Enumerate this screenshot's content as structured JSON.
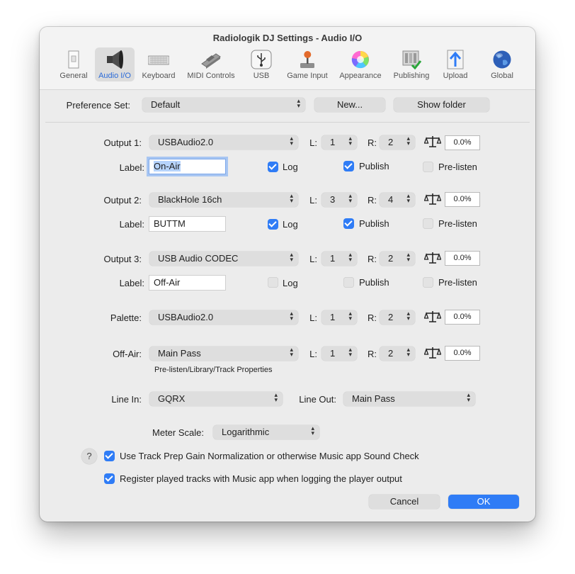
{
  "window": {
    "title": "Radiologik DJ Settings - Audio I/O"
  },
  "toolbar": [
    {
      "label": "General",
      "icon": "general-icon"
    },
    {
      "label": "Audio I/O",
      "icon": "speaker-icon",
      "selected": true
    },
    {
      "label": "Keyboard",
      "icon": "keyboard-icon"
    },
    {
      "label": "MIDI Controls",
      "icon": "midi-fader-icon"
    },
    {
      "label": "USB",
      "icon": "usb-icon"
    },
    {
      "label": "Game Input",
      "icon": "joystick-icon"
    },
    {
      "label": "Appearance",
      "icon": "color-wheel-icon"
    },
    {
      "label": "Publishing",
      "icon": "publishing-icon"
    },
    {
      "label": "Upload",
      "icon": "upload-arrow-icon"
    },
    {
      "label": "Global",
      "icon": "globe-icon"
    }
  ],
  "preference_set": {
    "label": "Preference Set:",
    "value": "Default",
    "new_button": "New...",
    "show_folder_button": "Show folder"
  },
  "common": {
    "label_text": "Label:",
    "l_text": "L:",
    "r_text": "R:",
    "log_text": "Log",
    "publish_text": "Publish",
    "prelisten_text": "Pre-listen"
  },
  "outputs": [
    {
      "name": "Output 1:",
      "device": "USBAudio2.0",
      "l": "1",
      "r": "2",
      "gain": "0.0%",
      "label_value": "On-Air",
      "log": true,
      "publish": true,
      "prelisten": false
    },
    {
      "name": "Output 2:",
      "device": "BlackHole 16ch",
      "l": "3",
      "r": "4",
      "gain": "0.0%",
      "label_value": "BUTTM",
      "log": true,
      "publish": true,
      "prelisten": false
    },
    {
      "name": "Output 3:",
      "device": "USB Audio CODEC",
      "l": "1",
      "r": "2",
      "gain": "0.0%",
      "label_value": "Off-Air",
      "log": false,
      "publish": false,
      "prelisten": false
    }
  ],
  "palette": {
    "name": "Palette:",
    "device": "USBAudio2.0",
    "l": "1",
    "r": "2",
    "gain": "0.0%"
  },
  "off_air": {
    "name": "Off-Air:",
    "device": "Main Pass",
    "l": "1",
    "r": "2",
    "gain": "0.0%",
    "note": "Pre-listen/Library/Track Properties"
  },
  "line_in": {
    "label": "Line In:",
    "value": "GQRX"
  },
  "line_out": {
    "label": "Line Out:",
    "value": "Main Pass"
  },
  "meter_scale": {
    "label": "Meter Scale:",
    "value": "Logarithmic"
  },
  "options": [
    {
      "label": "Use Track Prep Gain Normalization or otherwise Music app Sound Check",
      "checked": true
    },
    {
      "label": "Register played tracks with Music app when logging the player output",
      "checked": true
    }
  ],
  "help_glyph": "?",
  "buttons": {
    "cancel": "Cancel",
    "ok": "OK"
  },
  "colors": {
    "accent": "#2f7cf6",
    "window_bg": "#ececec",
    "toolbar_bg": "#f3f3f3"
  }
}
